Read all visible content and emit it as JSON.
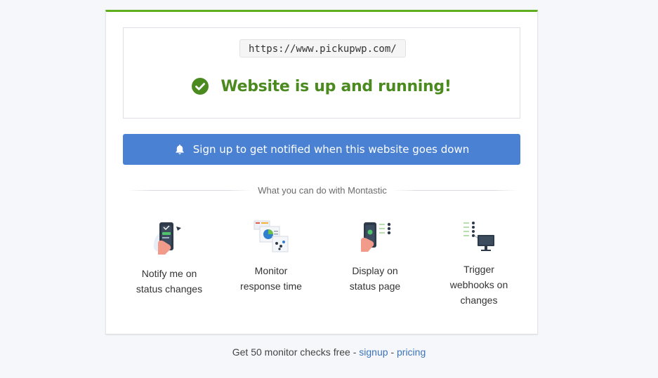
{
  "status": {
    "url": "https://www.pickupwp.com/",
    "message": "Website is up and running!",
    "color": "#4a8a1e"
  },
  "notify_button": {
    "label": "Sign up to get notified when this website goes down",
    "icon": "bell-icon",
    "color": "#4a81d3"
  },
  "divider": {
    "label": "What you can do with Montastic"
  },
  "features": [
    {
      "label": "Notify me on status changes",
      "icon": "phone-notify-icon"
    },
    {
      "label": "Monitor response time",
      "icon": "response-chart-icon"
    },
    {
      "label": "Display on status page",
      "icon": "status-page-icon"
    },
    {
      "label": "Trigger webhooks on changes",
      "icon": "webhook-monitor-icon"
    }
  ],
  "footer": {
    "text": "Get 50 monitor checks free -",
    "signup": "signup",
    "separator": "-",
    "pricing": "pricing"
  },
  "colors": {
    "accent_green": "#5fae1e",
    "link_blue": "#3b73b9"
  }
}
